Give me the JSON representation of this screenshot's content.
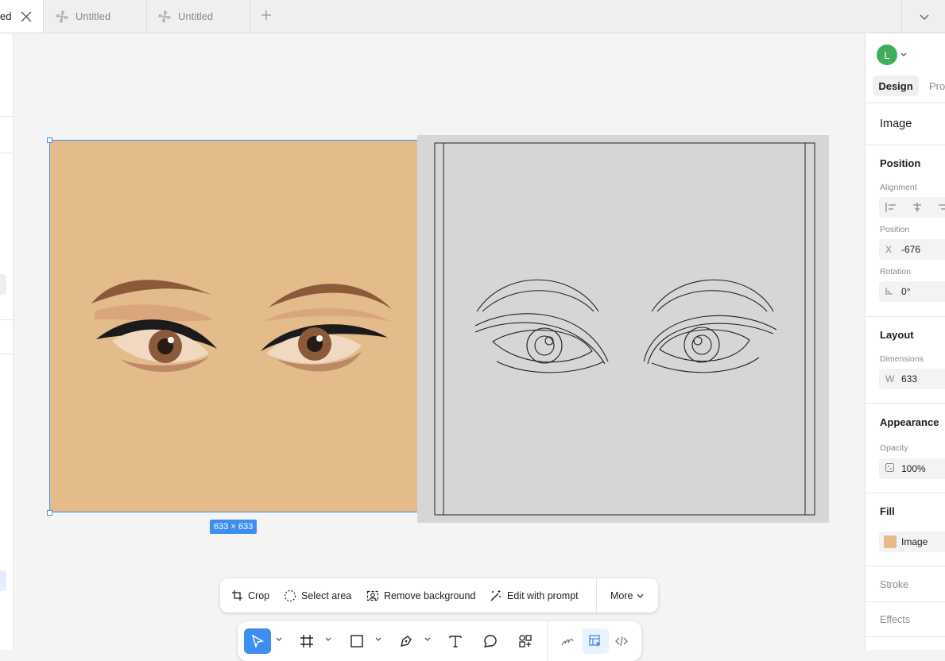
{
  "tabs": [
    {
      "label": "ed",
      "active": true
    },
    {
      "label": "Untitled",
      "active": false
    },
    {
      "label": "Untitled",
      "active": false
    }
  ],
  "canvas": {
    "selection_badge": "633 × 633"
  },
  "image_toolbar": {
    "crop": "Crop",
    "select_area": "Select area",
    "remove_background": "Remove background",
    "edit_with_prompt": "Edit with prompt",
    "more": "More"
  },
  "right_panel": {
    "avatar_initial": "L",
    "avatar_color": "#3fae5a",
    "tabs": {
      "design": "Design",
      "prototype": "Pro"
    },
    "selection_type": "Image",
    "position": {
      "title": "Position",
      "alignment_label": "Alignment",
      "position_label": "Position",
      "x_prefix": "X",
      "x_value": "-676",
      "rotation_label": "Rotation",
      "rotation_value": "0°"
    },
    "layout": {
      "title": "Layout",
      "dimensions_label": "Dimensions",
      "w_prefix": "W",
      "w_value": "633"
    },
    "appearance": {
      "title": "Appearance",
      "opacity_label": "Opacity",
      "opacity_value": "100%"
    },
    "fill": {
      "title": "Fill",
      "value": "Image"
    },
    "stroke": "Stroke",
    "effects": "Effects"
  },
  "colors": {
    "accent": "#3d8ef0",
    "skin": "#e4bb8a",
    "sketch_bg": "#d6d6d6"
  }
}
